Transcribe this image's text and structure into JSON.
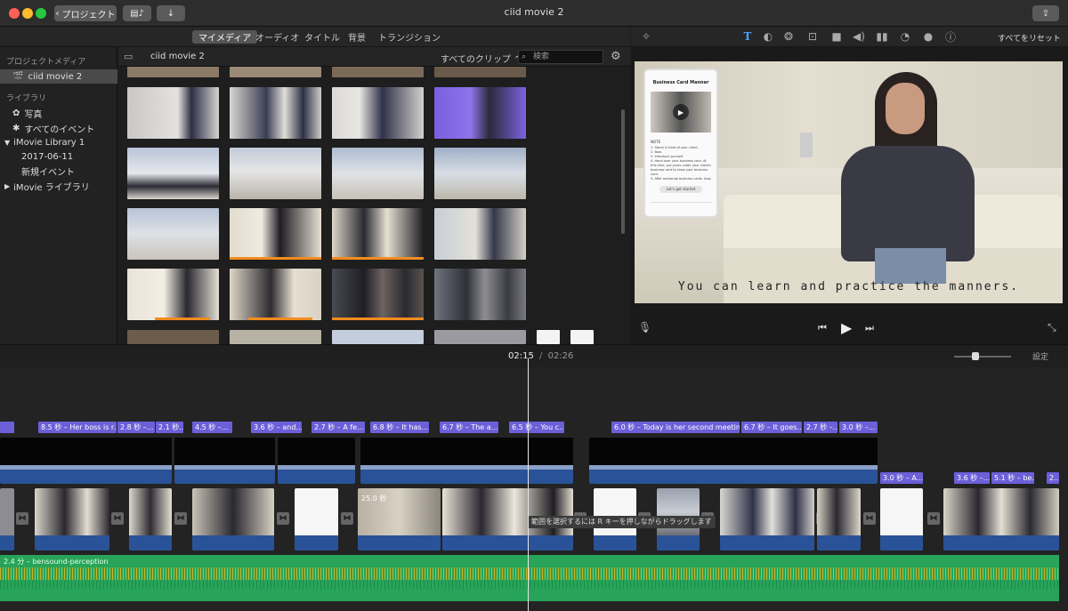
{
  "window": {
    "title": "ciid movie 2",
    "back_label": "プロジェクト"
  },
  "tabs": [
    {
      "label": "マイメディア",
      "active": true
    },
    {
      "label": "オーディオ",
      "active": false
    },
    {
      "label": "タイトル",
      "active": false
    },
    {
      "label": "背景",
      "active": false
    },
    {
      "label": "トランジション",
      "active": false
    }
  ],
  "sidebar": {
    "project_header": "プロジェクトメディア",
    "project_item": "ciid movie 2",
    "library_header": "ライブラリ",
    "photos": "写真",
    "all_events": "すべてのイベント",
    "library1": "iMovie Library 1",
    "date_event": "2017-06-11",
    "new_event": "新規イベント",
    "library2": "iMovie ライブラリ"
  },
  "browser": {
    "title": "ciid movie 2",
    "filter": "すべてのクリップ",
    "search_placeholder": "検索"
  },
  "inspector": {
    "reset_label": "すべてをリセット"
  },
  "viewer": {
    "subtitle": "You can learn and practice the manners.",
    "phone_title": "Business Card Manner",
    "phone_button": "Let's get started",
    "phone_note": "NOTE",
    "phone_steps": "1. Stand in front of your client.\n2. Bow.\n3. Introduce yourself.\n4. Hand over your business card. At this time, put yours under your client's business card to show your business card.\n5. After exchange business cards, bow."
  },
  "timeline": {
    "current_time": "02:15",
    "separator": "/",
    "total_time": "02:26",
    "settings_label": "設定",
    "titles": [
      {
        "label": ""
      },
      {
        "label": "8.5 秒 – Her boss is r..."
      },
      {
        "label": "2.8 秒 –..."
      },
      {
        "label": "2.1 秒..."
      },
      {
        "label": "4.5 秒 –..."
      },
      {
        "label": "3.6 秒 – and..."
      },
      {
        "label": "2.7 秒 – A fe..."
      },
      {
        "label": "6.8 秒 – It has..."
      },
      {
        "label": "6.7 秒 – The a..."
      },
      {
        "label": "6.5 秒 – You c..."
      },
      {
        "label": "6.0 秒 – Today is her second meeting..."
      },
      {
        "label": "6.7 秒 – It goes..."
      },
      {
        "label": "2.7 秒 –..."
      },
      {
        "label": "3.0 秒 –..."
      }
    ],
    "titles_row2": [
      {
        "label": "3.0 秒 – A..."
      },
      {
        "label": "3.6 秒 –..."
      },
      {
        "label": "5.1 秒 – be..."
      },
      {
        "label": "2..."
      }
    ],
    "clip_duration": "25.0 秒",
    "tooltip": "範囲を選択するには R キーを押しながらドラッグします",
    "audio_label": "2.4 分 – bensound-perception"
  },
  "colors": {
    "title_purple": "#6c5fd8",
    "clip_blue": "#2a5298",
    "audio_green": "#27a45a",
    "waveform_yellow": "#e0b321",
    "favorite_orange": "#f28c1e"
  }
}
